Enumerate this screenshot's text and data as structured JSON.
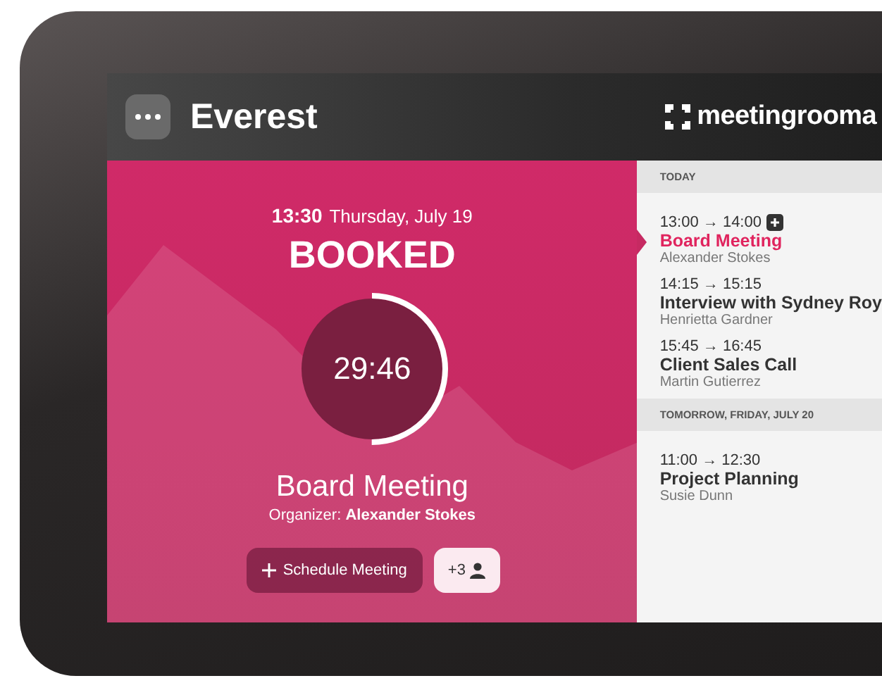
{
  "header": {
    "room_name": "Everest",
    "brand": "meetingrooma"
  },
  "status": {
    "time": "13:30",
    "date": "Thursday, July 19",
    "state": "BOOKED",
    "countdown": "29:46",
    "level": 0.5,
    "meeting_title": "Board Meeting",
    "organizer": "Organizer: **Alexander Stokes**"
  },
  "actions": {
    "schedule_button": "Schedule Meeting",
    "attendees": "+3"
  },
  "agenda": [
    {
      "heading": "TODAY",
      "events": [
        {
          "time": "13:00 → 14:00",
          "title": "Board Meeting",
          "organizer": "Alexander Stokes",
          "selected": true,
          "can_add": true
        },
        {
          "time": "14:15 → 15:15",
          "title": "Interview with Sydney Roy",
          "organizer": "Henrietta Gardner",
          "selected": false,
          "can_add": false
        },
        {
          "time": "15:45 → 16:45",
          "title": "Client Sales Call",
          "organizer": "Martin Gutierrez",
          "selected": false,
          "can_add": false
        }
      ]
    },
    {
      "heading": "TOMORROW, FRIDAY, JULY 20",
      "events": [
        {
          "time": "11:00 → 12:30",
          "title": "Project Planning",
          "organizer": "Susie Dunn",
          "selected": false,
          "can_add": false
        }
      ]
    }
  ]
}
